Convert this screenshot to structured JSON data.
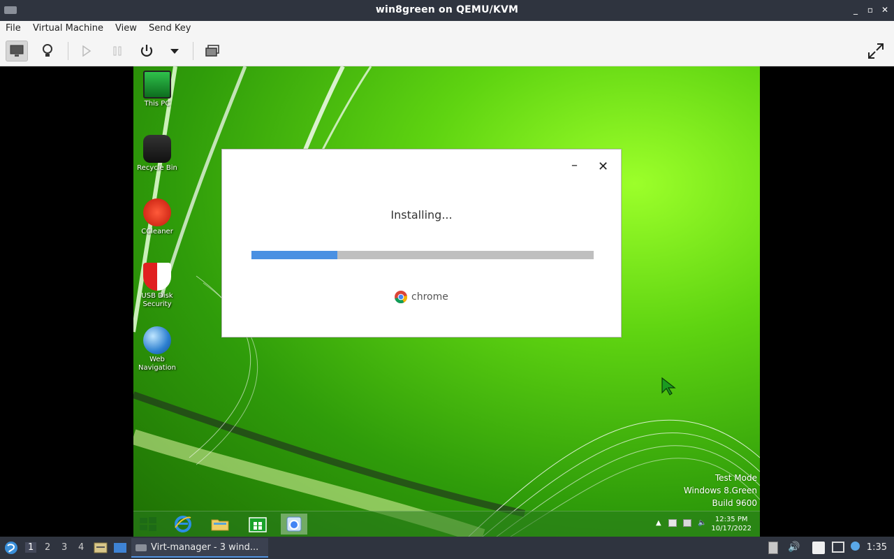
{
  "window": {
    "title": "win8green on QEMU/KVM",
    "controls": [
      "_",
      "▫",
      "✕"
    ]
  },
  "menubar": [
    "File",
    "Virtual Machine",
    "View",
    "Send Key"
  ],
  "desktop": {
    "icons": [
      {
        "label": "This PC",
        "icon": "monitor-icon"
      },
      {
        "label": "Recycle Bin",
        "icon": "recycle-bin-icon"
      },
      {
        "label": "CCleaner",
        "icon": "ccleaner-icon"
      },
      {
        "label": "USB Disk Security",
        "icon": "shield-icon"
      },
      {
        "label": "Web Navigation",
        "icon": "globe-icon"
      }
    ]
  },
  "dialog": {
    "minimize": "–",
    "close": "✕",
    "status": "Installing...",
    "progress": 0.25,
    "brand": "chrome"
  },
  "watermark": {
    "line1": "Test Mode",
    "line2": "Windows 8.Green",
    "line3": "Build 9600"
  },
  "guest_taskbar": {
    "time": "12:35 PM",
    "date": "10/17/2022"
  },
  "panel": {
    "workspaces": [
      "1",
      "2",
      "3",
      "4"
    ],
    "task_label": "Virt-manager - 3 wind...",
    "time": "1:35"
  },
  "colors": {
    "progress": "#4a90e2",
    "panel": "#2f343f",
    "accent": "#5294e2"
  }
}
